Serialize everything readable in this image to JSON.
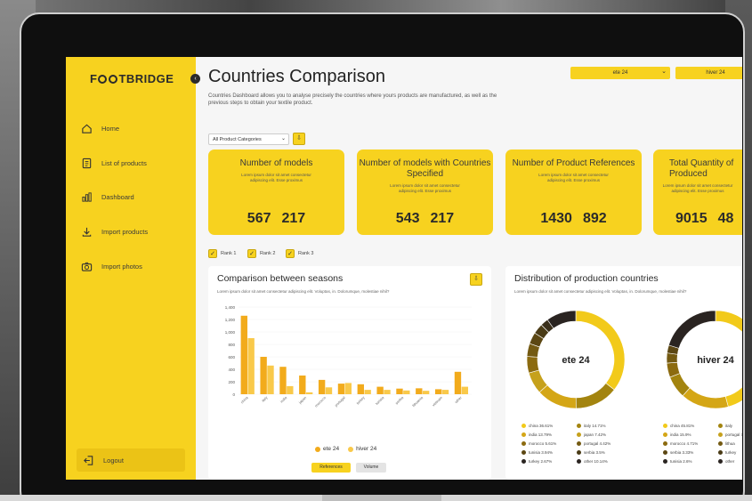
{
  "app": {
    "logo": "FOOTBRIDGE"
  },
  "sidebar": {
    "items": [
      {
        "label": "Home",
        "icon": "home-icon"
      },
      {
        "label": "List of products",
        "icon": "list-icon"
      },
      {
        "label": "Dashboard",
        "icon": "dashboard-icon"
      },
      {
        "label": "Import products",
        "icon": "import-icon"
      },
      {
        "label": "Import photos",
        "icon": "camera-icon"
      }
    ],
    "logout": "Logout"
  },
  "header": {
    "title": "Countries Comparison",
    "description": "Countries Dashboard allows you to analyse precisely the countries where yours products are manufactured, as well as the previous steps to obtain your textile product.",
    "season_select_1": "ete 24",
    "season_select_2": "hiver 24"
  },
  "filter": {
    "category": "All Product Categories"
  },
  "cards": [
    {
      "title": "Number of models",
      "sub": "Lorem ipsum dolor sit amet consectetur adipiscing elit. Esse proximus",
      "v1": "567",
      "v2": "217"
    },
    {
      "title": "Number of models with Countries Specified",
      "sub": "Lorem ipsum dolor sit amet consectetur adipiscing elit. Esse proximus",
      "v1": "543",
      "v2": "217"
    },
    {
      "title": "Number of Product References",
      "sub": "Lorem ipsum dolor sit amet consectetur adipiscing elit. Esse proximus",
      "v1": "1430",
      "v2": "892"
    },
    {
      "title": "Total Quantity of Produced",
      "sub": "Lorem ipsum dolor sit amet consectetur adipiscing elit. Esse proximus",
      "v1": "9015",
      "v2": "48"
    }
  ],
  "ranks": [
    "Rank 1",
    "Rank 2",
    "Rank 3"
  ],
  "seasons_panel": {
    "title": "Comparison between seasons",
    "subtitle": "Lorem ipsum dolor sit amet consectetur adipiscing elit. Voluptas, in. Dolorumque, molestiae nihil?",
    "legend_1": "ete 24",
    "legend_2": "hiver 24",
    "toggle_1": "References",
    "toggle_2": "Volume"
  },
  "distribution_panel": {
    "title": "Distribution of production countries",
    "subtitle": "Lorem ipsum dolor sit amet consectetur adipiscing elit. Voluptas, in. Dolorumque, molestiae nihil?",
    "donut_1": "ete 24",
    "donut_2": "hiver 24",
    "legend_1": [
      [
        "china 36.61%",
        "italy 14.71%"
      ],
      [
        "india 13.79%",
        "japan 7.42%"
      ],
      [
        "morocco 5.61%",
        "portugal 4.42%"
      ],
      [
        "tunisia 3.94%",
        "serbia 3.5%"
      ],
      [
        "turkey 2.67%",
        "other 10.14%"
      ]
    ],
    "legend_2": [
      [
        "china 45.81%",
        "italy"
      ],
      [
        "india 15.9%",
        "portugal 7.39%"
      ],
      [
        "morocco 4.71%",
        "lithua"
      ],
      [
        "serbia 3.33%",
        "turkey"
      ],
      [
        "tunisia 2.6%",
        "other"
      ]
    ]
  },
  "colors": {
    "accent": "#f7d21f",
    "ete": "#f2ab1c",
    "hiver": "#f9c94a"
  },
  "chart_data": [
    {
      "type": "bar",
      "title": "Comparison between seasons",
      "categories": [
        "china",
        "italy",
        "india",
        "japan",
        "morocco",
        "portugal",
        "turkey",
        "tunisia",
        "serbia",
        "lithuania",
        "vietnam",
        "other"
      ],
      "series": [
        {
          "name": "ete 24",
          "values": [
            1260,
            600,
            440,
            300,
            230,
            170,
            160,
            120,
            90,
            95,
            80,
            360
          ]
        },
        {
          "name": "hiver 24",
          "values": [
            900,
            460,
            130,
            30,
            110,
            180,
            70,
            70,
            60,
            55,
            70,
            120
          ]
        }
      ],
      "y_ticks": [
        "0",
        "200",
        "400",
        "600",
        "800",
        "1,000",
        "1,200",
        "1,400"
      ],
      "ylim": [
        0,
        1400
      ]
    },
    {
      "type": "pie",
      "title": "ete 24",
      "slices": [
        {
          "label": "china",
          "value": 36.61,
          "color": "#f2ca1a"
        },
        {
          "label": "italy",
          "value": 14.71,
          "color": "#a3840f"
        },
        {
          "label": "india",
          "value": 13.79,
          "color": "#d4a616"
        },
        {
          "label": "japan",
          "value": 7.42,
          "color": "#c6a11c"
        },
        {
          "label": "morocco",
          "value": 5.61,
          "color": "#8c6b10"
        },
        {
          "label": "portugal",
          "value": 4.42,
          "color": "#745a12"
        },
        {
          "label": "tunisia",
          "value": 3.94,
          "color": "#5c4713"
        },
        {
          "label": "serbia",
          "value": 3.5,
          "color": "#4a3b16"
        },
        {
          "label": "turkey",
          "value": 2.67,
          "color": "#3a2f1a"
        },
        {
          "label": "other",
          "value": 10.14,
          "color": "#2a2421"
        }
      ]
    },
    {
      "type": "pie",
      "title": "hiver 24",
      "slices": [
        {
          "label": "china",
          "value": 45.81,
          "color": "#f2ca1a"
        },
        {
          "label": "india",
          "value": 15.9,
          "color": "#d4a616"
        },
        {
          "label": "portugal",
          "value": 7.39,
          "color": "#a3840f"
        },
        {
          "label": "morocco",
          "value": 4.71,
          "color": "#8c6b10"
        },
        {
          "label": "serbia",
          "value": 3.33,
          "color": "#745a12"
        },
        {
          "label": "tunisia",
          "value": 2.6,
          "color": "#5c4713"
        },
        {
          "label": "other",
          "value": 20.26,
          "color": "#2a2421"
        }
      ]
    }
  ]
}
